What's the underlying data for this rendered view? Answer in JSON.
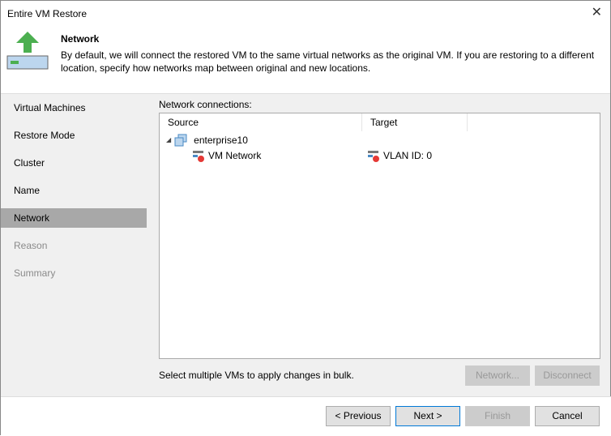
{
  "window": {
    "title": "Entire VM Restore"
  },
  "header": {
    "title": "Network",
    "description": "By default, we will connect the restored VM to the same virtual networks as the original VM. If you are restoring to a different location, specify how networks map between original and new locations."
  },
  "sidebar": {
    "items": [
      {
        "label": "Virtual Machines"
      },
      {
        "label": "Restore Mode"
      },
      {
        "label": "Cluster"
      },
      {
        "label": "Name"
      },
      {
        "label": "Network"
      },
      {
        "label": "Reason"
      },
      {
        "label": "Summary"
      }
    ]
  },
  "main": {
    "label": "Network connections:",
    "columns": [
      "Source",
      "Target"
    ],
    "vm": "enterprise10",
    "rows": [
      {
        "source": "VM Network",
        "target": "VLAN ID: 0"
      }
    ],
    "hint": "Select multiple VMs to apply changes in bulk.",
    "network_btn": "Network...",
    "disconnect_btn": "Disconnect"
  },
  "footer": {
    "previous": "< Previous",
    "next": "Next >",
    "finish": "Finish",
    "cancel": "Cancel"
  }
}
